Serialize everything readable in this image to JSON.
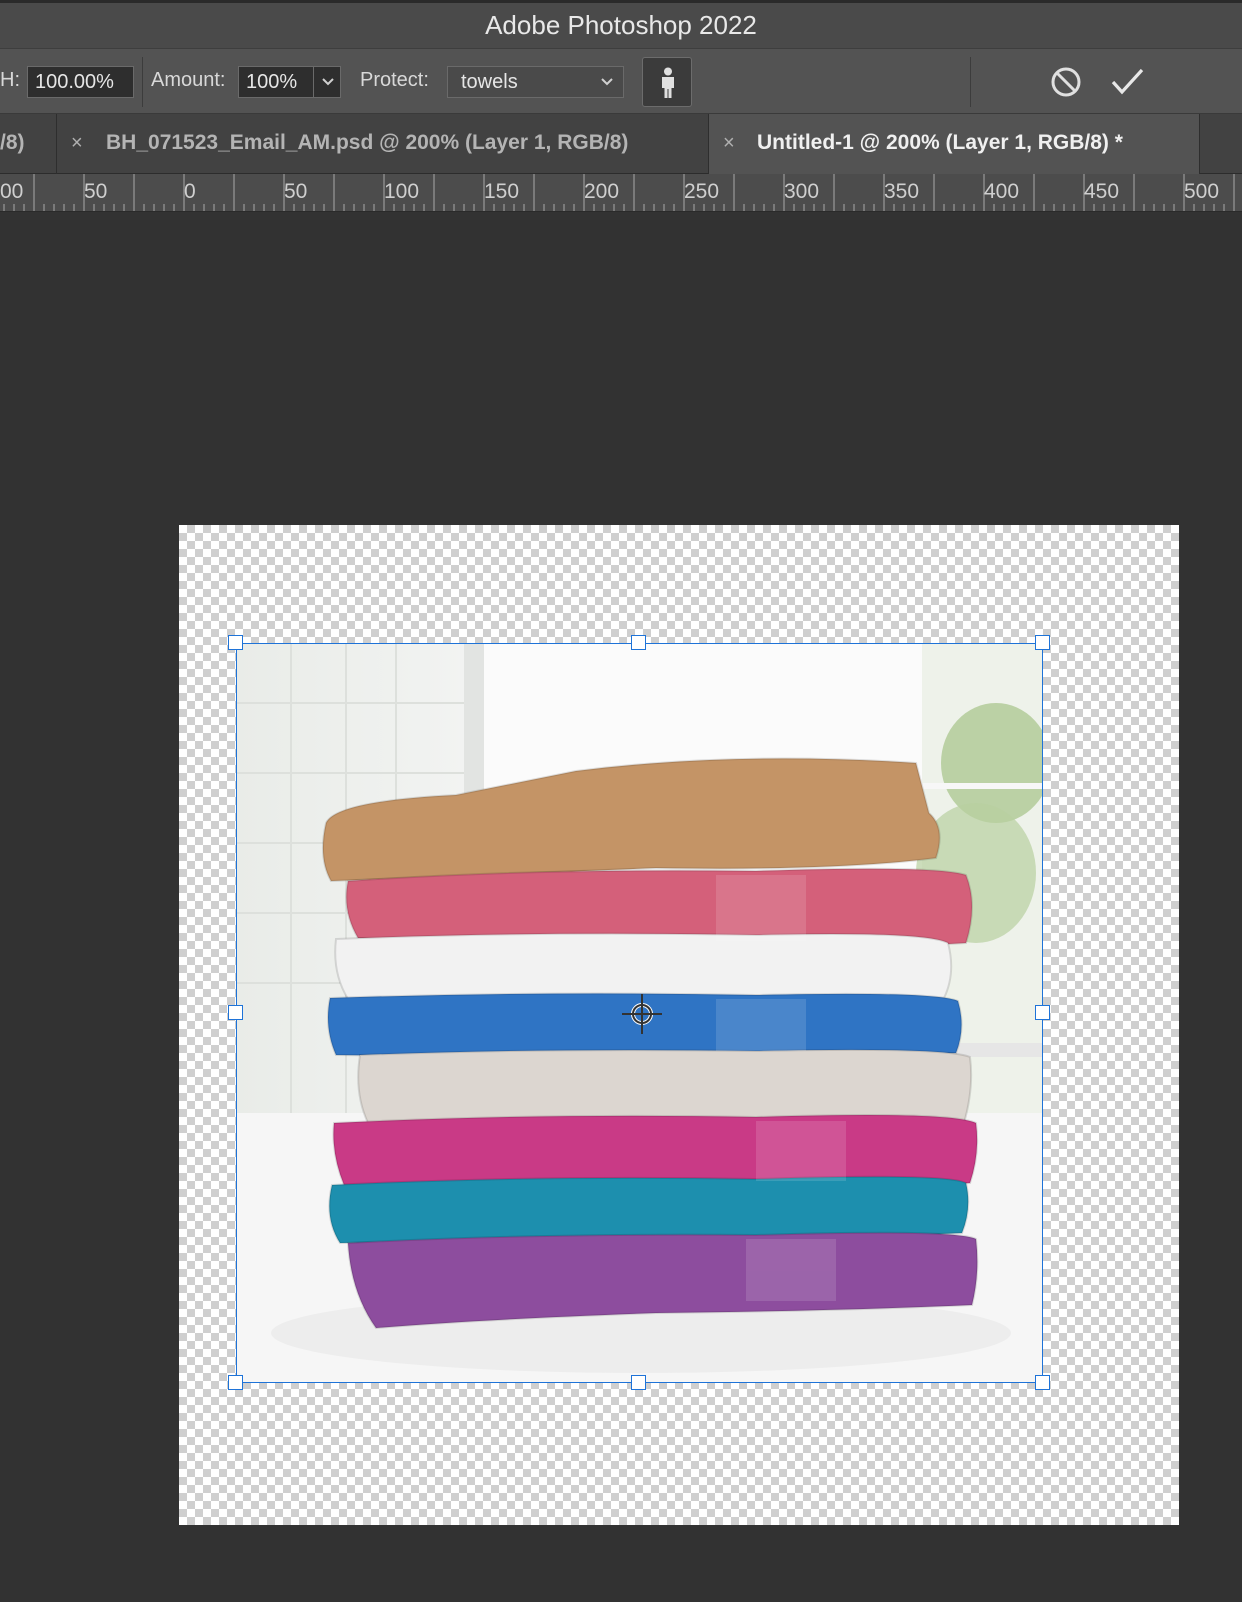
{
  "window": {
    "title": "Adobe Photoshop 2022"
  },
  "options_bar": {
    "height_label": "H:",
    "height_value": "100.00%",
    "amount_label": "Amount:",
    "amount_value": "100%",
    "protect_label": "Protect:",
    "protect_value": "towels",
    "protect_skin_icon": "person-icon",
    "cancel_icon": "cancel-icon",
    "commit_icon": "checkmark-icon"
  },
  "tabs": [
    {
      "label": "/8)",
      "active": false
    },
    {
      "label": "BH_071523_Email_AM.psd @ 200% (Layer 1, RGB/8)",
      "close": "×",
      "active": false
    },
    {
      "label": "Untitled-1 @ 200% (Layer 1, RGB/8) *",
      "close": "×",
      "active": true
    }
  ],
  "ruler": {
    "labels": [
      "00",
      "50",
      "0",
      "50",
      "100",
      "150",
      "200",
      "250",
      "300",
      "350",
      "400",
      "450",
      "500"
    ]
  },
  "canvas": {
    "content": "stack of folded towels",
    "towel_colors": [
      "#c49466",
      "#d4607a",
      "#f2f2f2",
      "#2f74c4",
      "#dcd6d0",
      "#c93a86",
      "#1d8fae",
      "#8d4d9e"
    ],
    "selection_color": "#1e73d8"
  }
}
